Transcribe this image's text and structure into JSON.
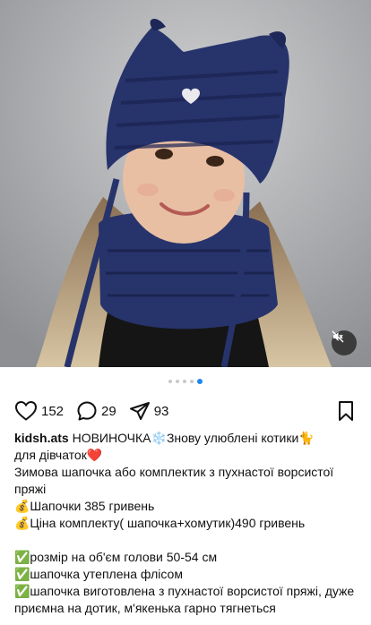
{
  "post": {
    "media_description_icon": "photo",
    "mute_icon": "speaker-muted-icon",
    "carousel": {
      "total": 5,
      "active": 5
    },
    "actions": {
      "likes": "152",
      "comments": "29",
      "shares": "93"
    },
    "caption": {
      "username": "kidsh.ats",
      "line1": "НОВИНОЧКА❄️Знову улюблені котики🐈",
      "line2": "для дівчаток❤️",
      "line3": "Зимова шапочка або комплектик з пухнастої ворсистої пряжі",
      "line4": "💰Шапочки 385  гривень",
      "line5": "💰Ціна комплекту( шапочка+хомутик)490 гривень",
      "line6": "✅розмір на об'єм голови 50-54 см",
      "line7": "✅шапочка утеплена флісом",
      "line8": "✅шапочка виготовлена з пухнастої ворсистої пряжі, дуже приємна на дотик, м'якенька гарно тягнеться"
    }
  },
  "colors": {
    "accent": "#1d88ee",
    "hat": "#27336b",
    "text": "#111111"
  }
}
